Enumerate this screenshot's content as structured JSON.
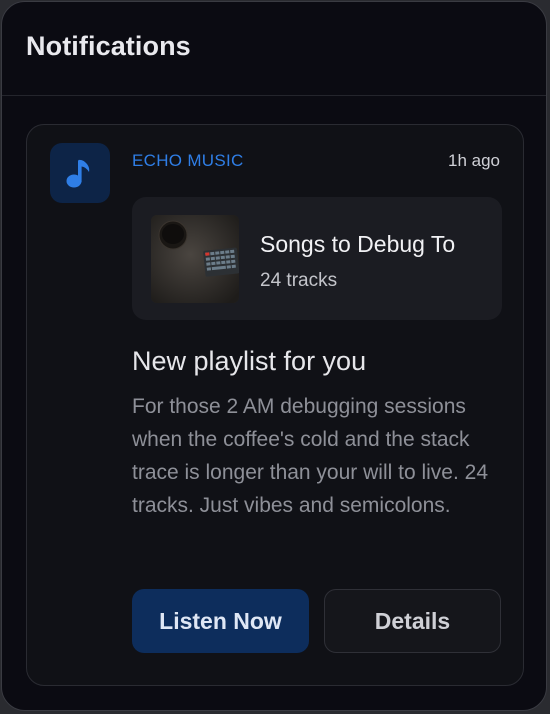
{
  "header": {
    "title": "Notifications"
  },
  "notification": {
    "app_icon": "music-note-icon",
    "app_name": "ECHO MUSIC",
    "time": "1h ago",
    "playlist": {
      "title": "Songs to Debug To",
      "subtitle": "24 tracks"
    },
    "headline": "New playlist for you",
    "body": "For those 2 AM debugging sessions when the coffee's cold and the stack trace is longer than your will to live. 24 tracks. Just vibes and semicolons.",
    "actions": {
      "primary_label": "Listen Now",
      "secondary_label": "Details"
    }
  },
  "colors": {
    "accent": "#2f7ee6",
    "primary_button": "#0d2d5c",
    "background": "#0b0b12"
  }
}
